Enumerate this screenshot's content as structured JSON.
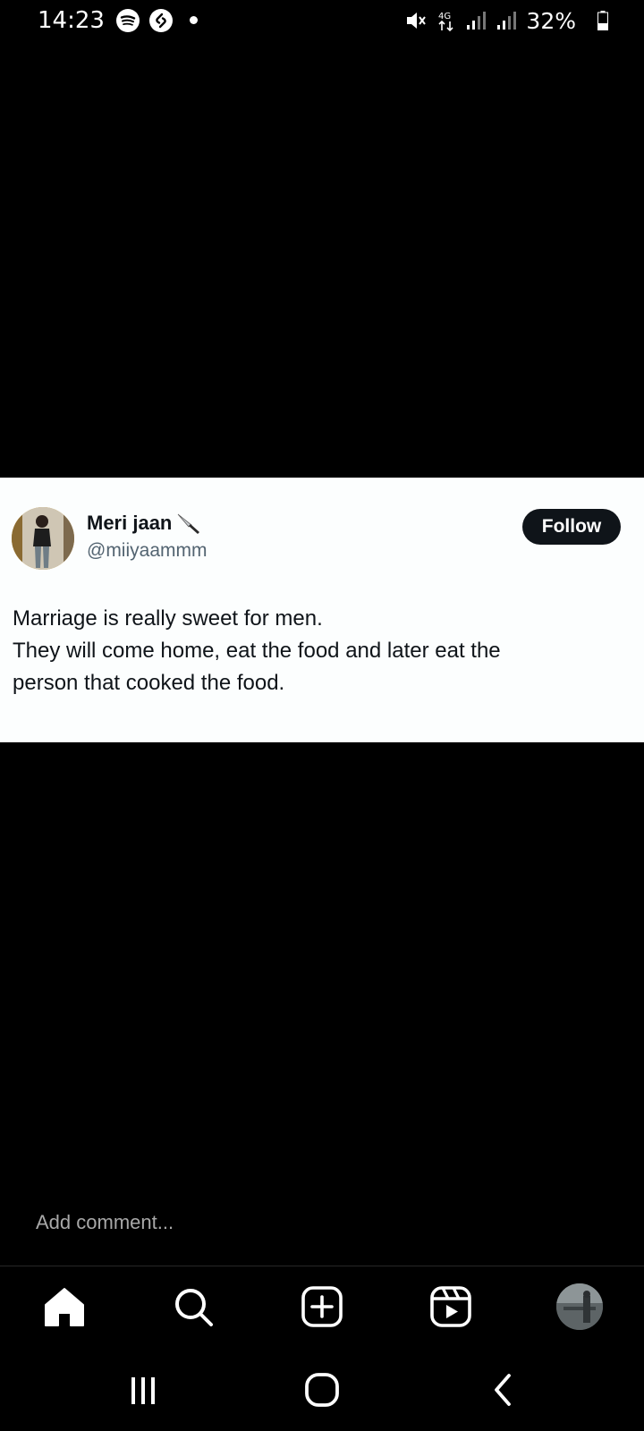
{
  "status_bar": {
    "time": "14:23",
    "battery": "32%",
    "network": "4G",
    "icons": [
      "spotify-icon",
      "shazam-icon",
      "notification-dot",
      "mute-icon",
      "4g-data-icon",
      "signal-icon",
      "signal-icon",
      "battery-icon"
    ]
  },
  "post": {
    "display_name": "Meri jaan",
    "display_name_emoji": "knife-icon",
    "username": "@miiyaammm",
    "follow_label": "Follow",
    "text_lines": [
      "Marriage is really sweet for men.",
      "They will come home, eat the food and later eat the",
      "person that cooked the food."
    ]
  },
  "comment": {
    "placeholder": "Add comment..."
  },
  "bottom_nav": {
    "items": [
      "home-icon",
      "search-icon",
      "create-icon",
      "reels-icon",
      "profile-avatar"
    ]
  },
  "system_nav": {
    "items": [
      "recent-apps-icon",
      "home-button-icon",
      "back-icon"
    ]
  },
  "colors": {
    "background": "#000000",
    "card_background": "#fcfefe",
    "follow_button": "#0f1419",
    "username": "#536471",
    "placeholder": "#a8a8a8"
  }
}
